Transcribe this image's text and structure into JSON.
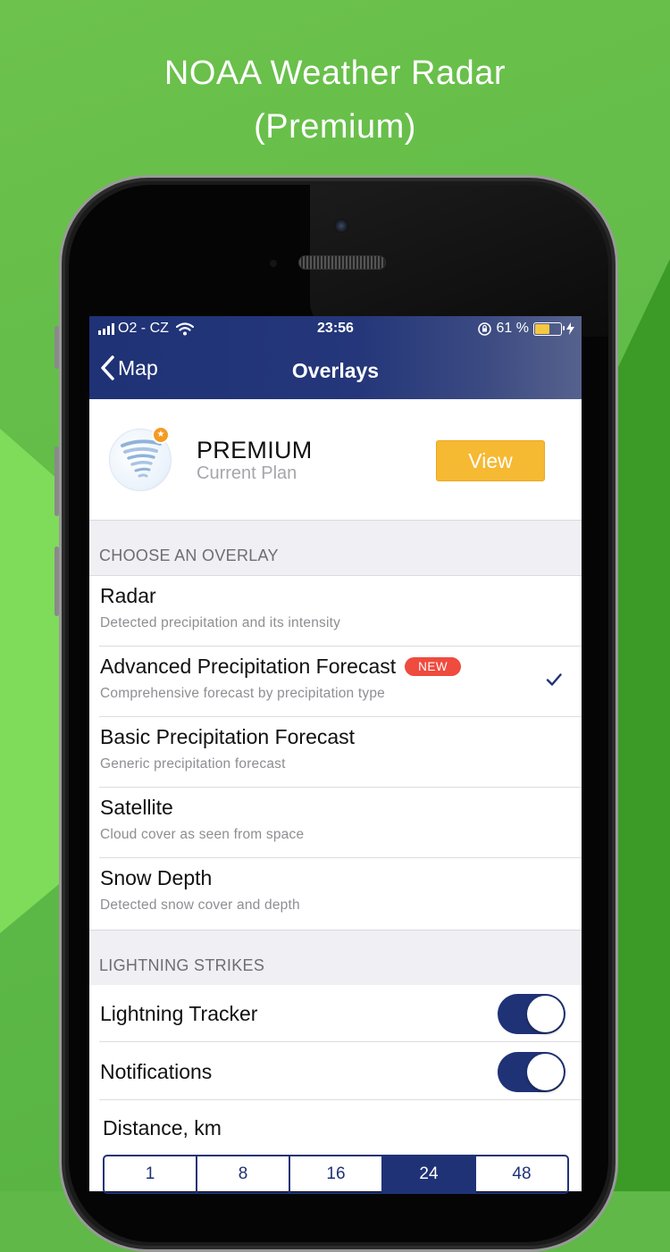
{
  "headline": {
    "line1": "NOAA Weather Radar",
    "line2": "(Premium)"
  },
  "status_bar": {
    "carrier": "O2 - CZ",
    "time": "23:56",
    "battery_percent": "61 %",
    "battery_level": 0.61
  },
  "navbar": {
    "back_label": "Map",
    "title": "Overlays"
  },
  "plan": {
    "name": "PREMIUM",
    "subtitle": "Current Plan",
    "button_label": "View"
  },
  "sections": {
    "overlays_header": "CHOOSE AN OVERLAY",
    "lightning_header": "LIGHTNING STRIKES"
  },
  "overlays": [
    {
      "title": "Radar",
      "description": "Detected precipitation and its intensity",
      "badge": "",
      "selected": false
    },
    {
      "title": "Advanced Precipitation Forecast",
      "description": "Comprehensive forecast by precipitation type",
      "badge": "NEW",
      "selected": true
    },
    {
      "title": "Basic Precipitation Forecast",
      "description": "Generic precipitation forecast",
      "badge": "",
      "selected": false
    },
    {
      "title": "Satellite",
      "description": "Cloud cover as seen from space",
      "badge": "",
      "selected": false
    },
    {
      "title": "Snow Depth",
      "description": "Detected snow cover and depth",
      "badge": "",
      "selected": false
    }
  ],
  "lightning": {
    "tracker_label": "Lightning Tracker",
    "tracker_on": true,
    "notifications_label": "Notifications",
    "notifications_on": true,
    "distance_label": "Distance, km",
    "distance_options": [
      "1",
      "8",
      "16",
      "24",
      "48"
    ],
    "distance_selected": "24"
  },
  "colors": {
    "brand_navy": "#1f3276",
    "accent_yellow": "#f6b932",
    "badge_red": "#ef4b3f",
    "background_green": "#5fb847"
  }
}
